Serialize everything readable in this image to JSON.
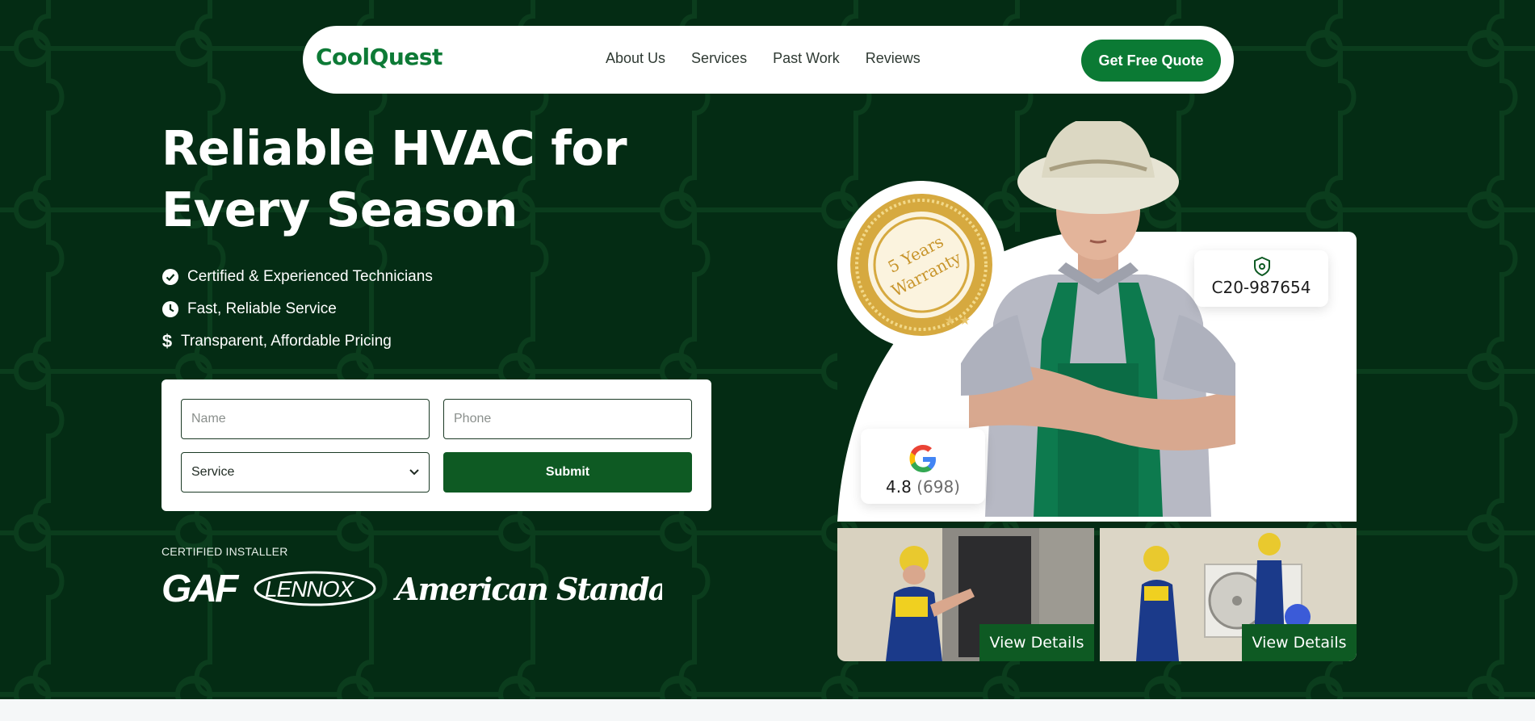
{
  "nav": {
    "logo": "CoolQuest",
    "links": [
      "About Us",
      "Services",
      "Past Work",
      "Reviews"
    ],
    "cta": "Get Free Quote"
  },
  "hero": {
    "headline": "Reliable HVAC for Every Season",
    "features": [
      {
        "icon": "check-circle-icon",
        "text": "Certified & Experienced Technicians"
      },
      {
        "icon": "clock-icon",
        "text": "Fast, Reliable Service"
      },
      {
        "icon": "dollar-icon",
        "text": "Transparent, Affordable Pricing"
      }
    ]
  },
  "form": {
    "name_placeholder": "Name",
    "phone_placeholder": "Phone",
    "service_selected": "Service",
    "submit_label": "Submit"
  },
  "certified": {
    "label": "CERTIFIED INSTALLER",
    "brands": [
      "GAF",
      "LENNOX",
      "American Standard"
    ]
  },
  "badges": {
    "warranty_line1": "5 Years",
    "warranty_line2": "Warranty",
    "license": "C20-987654",
    "rating": "4.8",
    "rating_count": "(698)"
  },
  "gallery": {
    "view_label_1": "View Details",
    "view_label_2": "View Details"
  },
  "colors": {
    "background": "#042c14",
    "brand_green": "#0b7a34",
    "button_dark_green": "#0e5a23",
    "nav_bg": "#ffffff"
  }
}
